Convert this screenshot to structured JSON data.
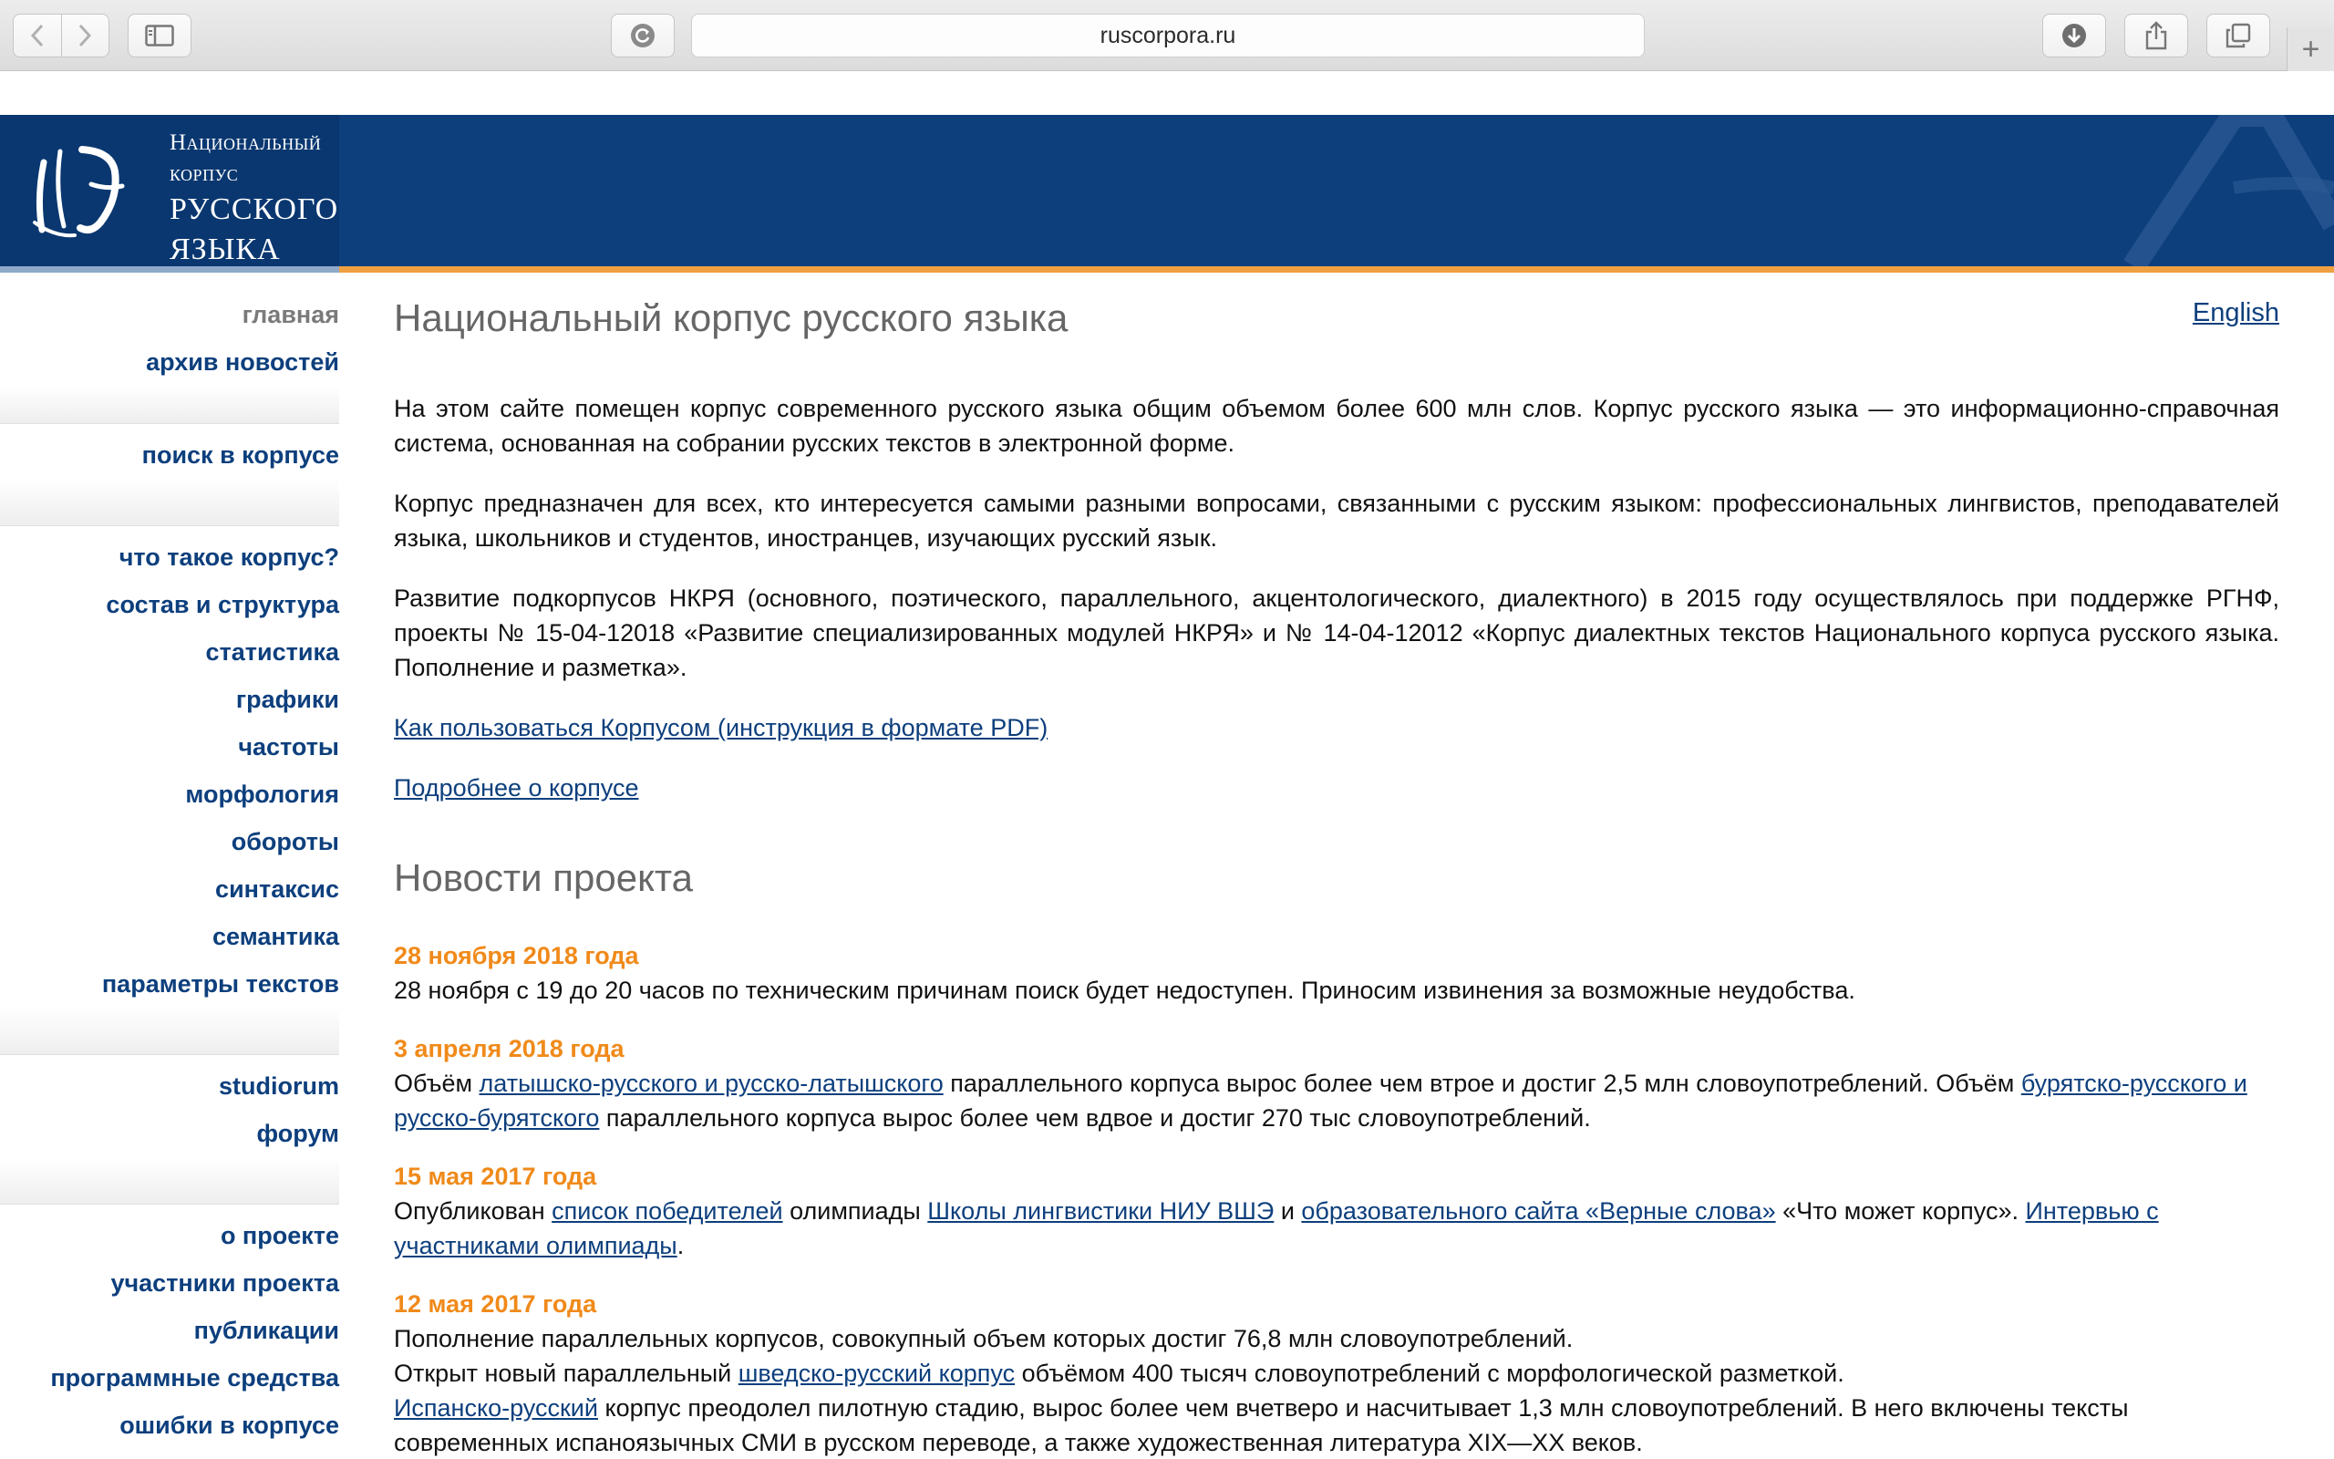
{
  "browser": {
    "url": "ruscorpora.ru",
    "icons": {
      "back": "chevron-left-icon",
      "forward": "chevron-right-icon",
      "sidebar": "sidebar-icon",
      "reload": "reload-icon",
      "download": "download-icon",
      "share": "share-icon",
      "tabs": "tabs-icon",
      "new_tab": "plus-icon"
    }
  },
  "header": {
    "logo_line1": "Национальный корпус",
    "logo_line2": "РУССКОГО",
    "logo_line3": "ЯЗЫКА",
    "bg_color": "#0d3f7d",
    "accent_color": "#f0a040"
  },
  "nav": {
    "group1": [
      "главная",
      "архив новостей"
    ],
    "group2": [
      "поиск в корпусе"
    ],
    "group3": [
      "что такое корпус?",
      "состав и структура",
      "статистика",
      "графики",
      "частоты",
      "морфология",
      "обороты",
      "синтаксис",
      "семантика",
      "параметры текстов"
    ],
    "group4": [
      "studiorum",
      "форум"
    ],
    "group5": [
      "о проекте",
      "участники проекта",
      "публикации",
      "программные средства",
      "ошибки в корпусе"
    ]
  },
  "main": {
    "title": "Национальный корпус русского языка",
    "english": "English",
    "p1": "На этом сайте помещен корпус современного русского языка общим объемом более 600 млн слов. Корпус русского языка — это информационно-справочная система, основанная на собрании русских текстов в электронной форме.",
    "p2": "Корпус предназначен для всех, кто интересуется самыми разными вопросами, связанными с русским языком: профессиональных лингвистов, преподавателей языка, школьников и студентов, иностранцев, изучающих русский язык.",
    "p3": "Развитие подкорпусов НКРЯ (основного, поэтического, параллельного, акцентологического, диалектного) в 2015 году осуществлялось при поддержке РГНФ, проекты № 15-04-12018 «Развитие специализированных модулей НКРЯ» и № 14-04-12012 «Корпус диалектных текстов Национального корпуса русского языка. Пополнение и разметка».",
    "link_howto": "Как пользоваться Корпусом (инструкция в формате PDF)",
    "link_more": "Подробнее о корпусе"
  },
  "news": {
    "title": "Новости проекта",
    "item1": {
      "date": "28 ноября 2018 года",
      "text": "28 ноября с 19 до 20 часов по техническим причинам поиск будет недоступен. Приносим извинения за возможные неудобства."
    },
    "item2": {
      "date": "3 апреля 2018 года",
      "t1": "Объём ",
      "l1": "латышско-русского и русско-латышского",
      "t2": " параллельного корпуса вырос более чем втрое и достиг 2,5 млн словоупотреблений. Объём ",
      "l2": "бурятско-русского и русско-бурятского",
      "t3": " параллельного корпуса вырос более чем вдвое и достиг 270 тыс словоупотреблений."
    },
    "item3": {
      "date": "15 мая 2017 года",
      "t1": "Опубликован ",
      "l1": "список победителей",
      "t2": " олимпиады ",
      "l2": "Школы лингвистики НИУ ВШЭ",
      "t3": " и ",
      "l3": "образовательного сайта «Верные слова»",
      "t4": " «Что может корпус». ",
      "l4": "Интервью с участниками олимпиады",
      "t5": "."
    },
    "item4": {
      "date": "12 мая 2017 года",
      "line1": "Пополнение параллельных корпусов, совокупный объем которых достиг 76,8 млн словоупотреблений.",
      "line2_t1": "Открыт новый параллельный ",
      "line2_l1": "шведско-русский корпус",
      "line2_t2": " объёмом 400 тысяч словоупотреблений с морфологической разметкой.",
      "line3_l1": "Испанско-русский",
      "line3_t1": " корпус преодолел пилотную стадию, вырос более чем вчетверо и насчитывает 1,3 млн словоупотреблений. В него включены тексты современных испаноязычных СМИ в русском переводе, а также художественная литература XIX—XX веков."
    }
  }
}
